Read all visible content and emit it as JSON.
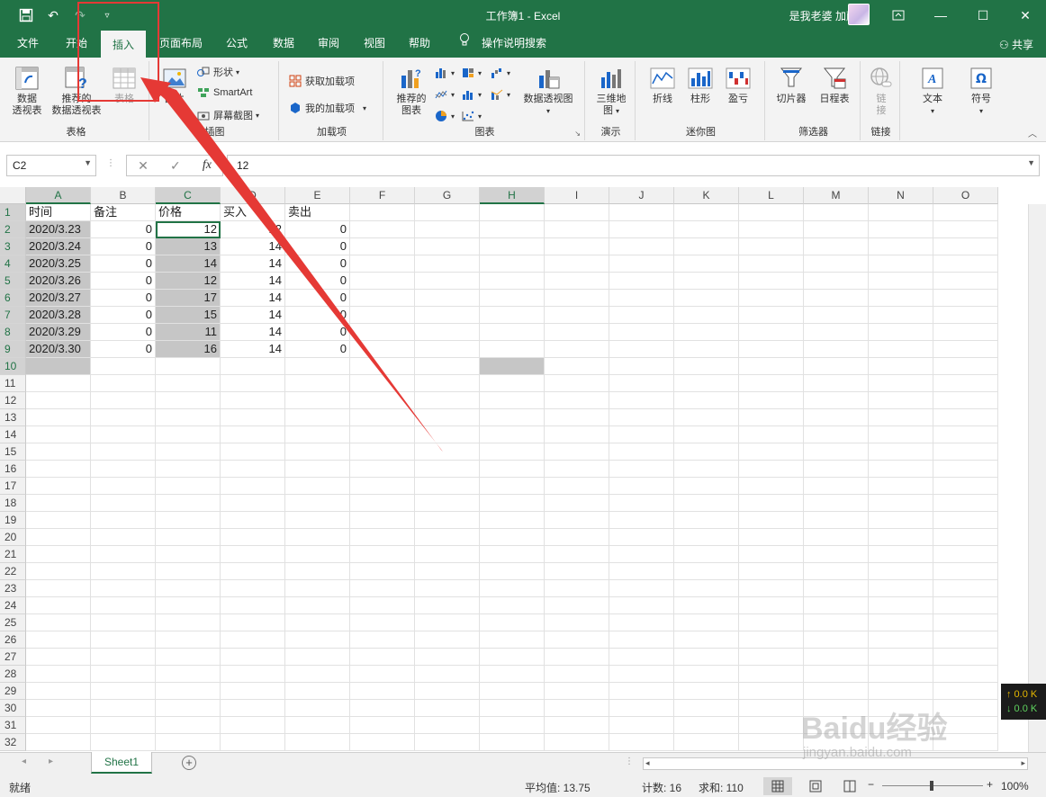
{
  "titlebar": {
    "doc_title": "工作簿1  -  Excel",
    "user": "是我老婆 加藤惠"
  },
  "tabs": [
    "文件",
    "开始",
    "插入",
    "页面布局",
    "公式",
    "数据",
    "审阅",
    "视图",
    "帮助",
    "操作说明搜索"
  ],
  "share": "共享",
  "ribbon": {
    "groups": {
      "tables": "表格",
      "illustrations": "插图",
      "addins": "加载项",
      "charts": "图表",
      "tours": "演示",
      "sparklines": "迷你图",
      "filters": "筛选器",
      "links": "链接"
    },
    "pivot": "数据\n透视表",
    "pivot_l1": "数据",
    "pivot_l2": "透视表",
    "rec_pivot_l1": "推荐的",
    "rec_pivot_l2": "数据透视表",
    "table": "表格",
    "picture": "图片",
    "shapes": "形状",
    "smartart": "SmartArt",
    "screenshot": "屏幕截图",
    "get_addins": "获取加载项",
    "my_addins": "我的加载项",
    "rec_charts_l1": "推荐的",
    "rec_charts_l2": "图表",
    "pivot_chart": "数据透视图",
    "map3d_l1": "三维地",
    "map3d_l2": "图",
    "line": "折线",
    "column": "柱形",
    "winloss": "盈亏",
    "slicer": "切片器",
    "timeline": "日程表",
    "link_l1": "链",
    "link_l2": "接",
    "text": "文本",
    "symbol": "符号"
  },
  "formula_bar": {
    "namebox": "C2",
    "fx": "fx",
    "value": "12"
  },
  "columns": [
    "A",
    "B",
    "C",
    "D",
    "E",
    "F",
    "G",
    "H",
    "I",
    "J",
    "K",
    "L",
    "M",
    "N",
    "O"
  ],
  "rows": [
    [
      "时间",
      "备注",
      "价格",
      "买入",
      "卖出"
    ],
    [
      "2020/3.23",
      "0",
      "12",
      "12",
      "0"
    ],
    [
      "2020/3.24",
      "0",
      "13",
      "14",
      "0"
    ],
    [
      "2020/3.25",
      "0",
      "14",
      "14",
      "0"
    ],
    [
      "2020/3.26",
      "0",
      "12",
      "14",
      "0"
    ],
    [
      "2020/3.27",
      "0",
      "17",
      "14",
      "0"
    ],
    [
      "2020/3.28",
      "0",
      "15",
      "14",
      "0"
    ],
    [
      "2020/3.29",
      "0",
      "11",
      "14",
      "0"
    ],
    [
      "2020/3.30",
      "0",
      "16",
      "14",
      "0"
    ]
  ],
  "row_count": 32,
  "sheet": {
    "name": "Sheet1"
  },
  "status": {
    "ready": "就绪",
    "average": "平均值: 13.75",
    "count": "计数: 16",
    "sum": "求和: 110",
    "zoom": "100%"
  },
  "overlay": {
    "net_up": "↑ 0.0 K",
    "net_down": "↓ 0.0 K",
    "watermark": "Baidu经验",
    "watermark_url": "jingyan.baidu.com"
  }
}
